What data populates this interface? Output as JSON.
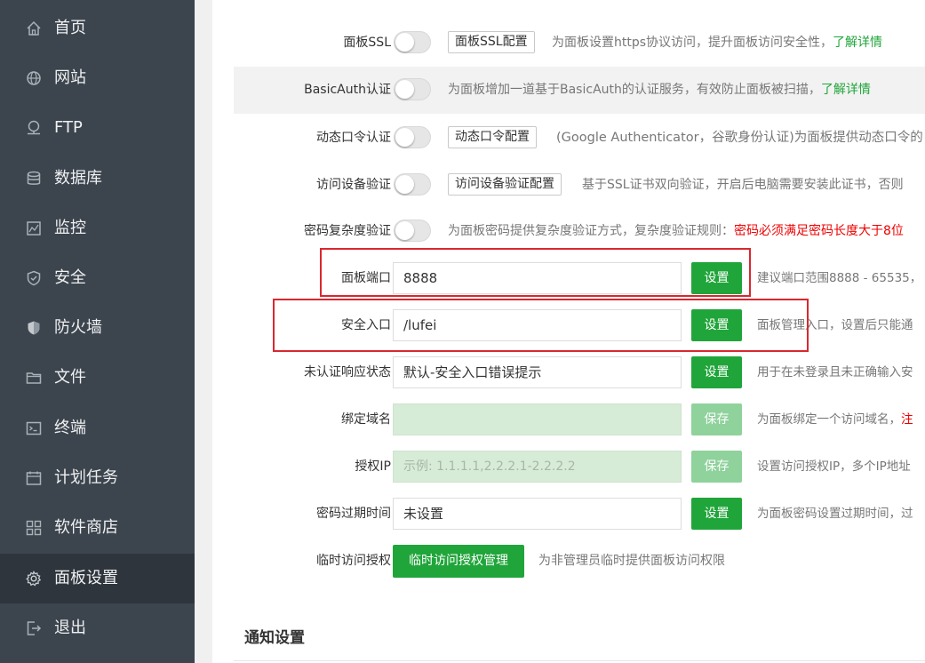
{
  "sidebar": {
    "items": [
      {
        "label": "首页",
        "icon": "home-icon"
      },
      {
        "label": "网站",
        "icon": "globe-icon"
      },
      {
        "label": "FTP",
        "icon": "ftp-icon"
      },
      {
        "label": "数据库",
        "icon": "database-icon"
      },
      {
        "label": "监控",
        "icon": "monitor-icon"
      },
      {
        "label": "安全",
        "icon": "shield-icon"
      },
      {
        "label": "防火墙",
        "icon": "firewall-icon"
      },
      {
        "label": "文件",
        "icon": "folder-icon"
      },
      {
        "label": "终端",
        "icon": "terminal-icon"
      },
      {
        "label": "计划任务",
        "icon": "calendar-icon"
      },
      {
        "label": "软件商店",
        "icon": "apps-icon"
      },
      {
        "label": "面板设置",
        "icon": "gear-icon"
      },
      {
        "label": "退出",
        "icon": "logout-icon"
      }
    ],
    "active_index": 11
  },
  "settings": {
    "ssl": {
      "label": "面板SSL",
      "button": "面板SSL配置",
      "desc": "为面板设置https协议访问，提升面板访问安全性，",
      "link": "了解详情",
      "enabled": false
    },
    "basicauth": {
      "label": "BasicAuth认证",
      "desc": "为面板增加一道基于BasicAuth的认证服务，有效防止面板被扫描，",
      "link": "了解详情",
      "enabled": false
    },
    "dynamic_pwd": {
      "label": "动态口令认证",
      "button": "动态口令配置",
      "desc": "(Google Authenticator，谷歌身份认证)为面板提供动态口令的",
      "enabled": false
    },
    "device_verify": {
      "label": "访问设备验证",
      "button": "访问设备验证配置",
      "desc": "基于SSL证书双向验证，开启后电脑需要安装此证书，否则",
      "enabled": false
    },
    "pwd_complexity": {
      "label": "密码复杂度验证",
      "desc": "为面板密码提供复杂度验证方式，复杂度验证规则：",
      "desc_red": "密码必须满足密码长度大于8位",
      "enabled": false
    },
    "port": {
      "label": "面板端口",
      "value": "8888",
      "button": "设置",
      "desc": "建议端口范围8888 - 65535，"
    },
    "entrance": {
      "label": "安全入口",
      "value": "/lufei",
      "button": "设置",
      "desc": "面板管理入口，设置后只能通"
    },
    "unauth_status": {
      "label": "未认证响应状态",
      "value": "默认-安全入口错误提示",
      "button": "设置",
      "desc": "用于在未登录且未正确输入安"
    },
    "domain": {
      "label": "绑定域名",
      "value": "",
      "button": "保存",
      "desc": "为面板绑定一个访问域名，",
      "desc_red": "注"
    },
    "auth_ip": {
      "label": "授权IP",
      "placeholder": "示例: 1.1.1.1,2.2.2.1-2.2.2.2",
      "button": "保存",
      "desc": "设置访问授权IP，多个IP地址"
    },
    "pwd_expire": {
      "label": "密码过期时间",
      "value": "未设置",
      "button": "设置",
      "desc": "为面板密码设置过期时间，过"
    },
    "temp_access": {
      "label": "临时访问授权",
      "button": "临时访问授权管理",
      "desc": "为非管理员临时提供面板访问权限"
    }
  },
  "notify": {
    "title": "通知设置"
  },
  "colors": {
    "accent": "#20a53a",
    "sidebar_bg": "#3c444d",
    "highlight": "#d9282f"
  }
}
